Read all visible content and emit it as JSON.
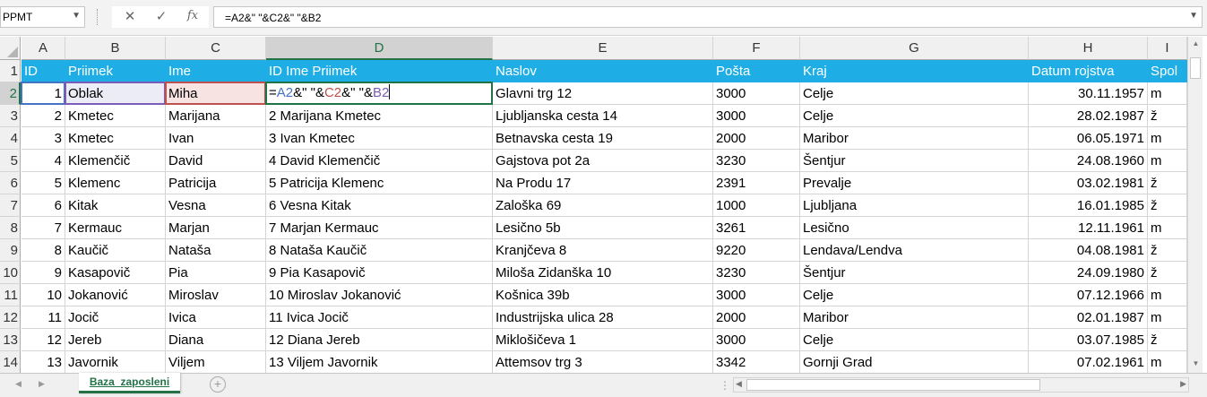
{
  "formula_bar": {
    "name_box": "PPMT",
    "cancel_glyph": "✕",
    "enter_glyph": "✓",
    "fx_glyph": "fx",
    "formula": "=A2&\" \"&C2&\" \"&B2"
  },
  "active_cell": {
    "prefix": "=",
    "ref1": "A2",
    "sep1": "&\" \"&",
    "ref2": "C2",
    "sep2": "&\" \"&",
    "ref3": "B2"
  },
  "columns": [
    "A",
    "B",
    "C",
    "D",
    "E",
    "F",
    "G",
    "H",
    "I"
  ],
  "header_row": [
    "ID",
    "Priimek",
    "Ime",
    "ID Ime Priimek",
    "Naslov",
    "Pošta",
    "Kraj",
    "Datum rojstva",
    "Spol"
  ],
  "row_numbers": [
    "1",
    "2",
    "3",
    "4",
    "5",
    "6",
    "7",
    "8",
    "9",
    "10",
    "11",
    "12",
    "13",
    "14"
  ],
  "rows": [
    [
      "1",
      "Oblak",
      "Miha",
      "",
      "Glavni trg 12",
      "3000",
      "Celje",
      "30.11.1957",
      "m"
    ],
    [
      "2",
      "Kmetec",
      "Marijana",
      "2 Marijana Kmetec",
      "Ljubljanska cesta 14",
      "3000",
      "Celje",
      "28.02.1987",
      "ž"
    ],
    [
      "3",
      "Kmetec",
      "Ivan",
      "3 Ivan Kmetec",
      "Betnavska cesta 19",
      "2000",
      "Maribor",
      "06.05.1971",
      "m"
    ],
    [
      "4",
      "Klemenčič",
      "David",
      "4 David Klemenčič",
      "Gajstova pot 2a",
      "3230",
      "Šentjur",
      "24.08.1960",
      "m"
    ],
    [
      "5",
      "Klemenc",
      "Patricija",
      "5 Patricija Klemenc",
      "Na Produ 17",
      "2391",
      "Prevalje",
      "03.02.1981",
      "ž"
    ],
    [
      "6",
      "Kitak",
      "Vesna",
      "6 Vesna Kitak",
      "Zaloška 69",
      "1000",
      "Ljubljana",
      "16.01.1985",
      "ž"
    ],
    [
      "7",
      "Kermauc",
      "Marjan",
      "7 Marjan Kermauc",
      "Lesično 5b",
      "3261",
      "Lesično",
      "12.11.1961",
      "m"
    ],
    [
      "8",
      "Kaučič",
      "Nataša",
      "8 Nataša Kaučič",
      "Kranjčeva 8",
      "9220",
      "Lendava/Lendva",
      "04.08.1981",
      "ž"
    ],
    [
      "9",
      "Kasapovič",
      "Pia",
      "9 Pia Kasapovič",
      "Miloša Zidanška 10",
      "3230",
      "Šentjur",
      "24.09.1980",
      "ž"
    ],
    [
      "10",
      "Jokanović",
      "Miroslav",
      "10 Miroslav Jokanović",
      "Košnica 39b",
      "3000",
      "Celje",
      "07.12.1966",
      "m"
    ],
    [
      "11",
      "Jocič",
      "Ivica",
      "11 Ivica Jocič",
      "Industrijska ulica 28",
      "2000",
      "Maribor",
      "02.01.1987",
      "m"
    ],
    [
      "12",
      "Jereb",
      "Diana",
      "12 Diana Jereb",
      "Miklošičeva 1",
      "3000",
      "Celje",
      "03.07.1985",
      "ž"
    ],
    [
      "13",
      "Javornik",
      "Viljem",
      "13 Viljem Javornik",
      "Attemsov trg 3",
      "3342",
      "Gornji Grad",
      "07.02.1961",
      "m"
    ]
  ],
  "sheet_tab": "Baza_zaposleni",
  "add_sheet_glyph": "+",
  "tab_separator": "⋮",
  "colors": {
    "header_fill": "#1eaee5",
    "accent": "#217346"
  }
}
